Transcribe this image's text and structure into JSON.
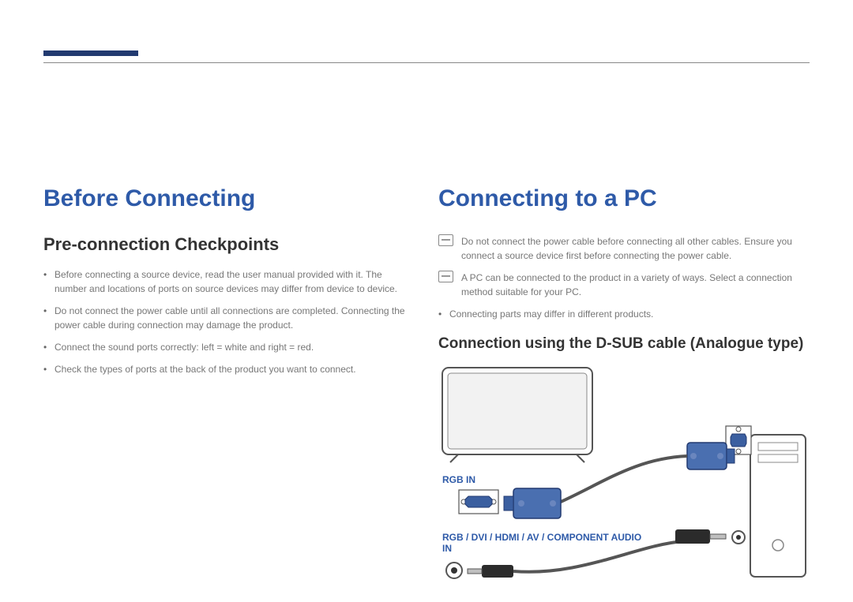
{
  "left": {
    "heading": "Before Connecting",
    "subheading": "Pre-connection Checkpoints",
    "bullets": [
      "Before connecting a source device, read the user manual provided with it.\nThe number and locations of ports on source devices may differ from device to device.",
      "Do not connect the power cable until all connections are completed.\nConnecting the power cable during connection may damage the product.",
      "Connect the sound ports correctly: left = white and right = red.",
      "Check the types of ports at the back of the product you want to connect."
    ]
  },
  "right": {
    "heading": "Connecting to a PC",
    "notes": [
      "Do not connect the power cable before connecting all other cables.\nEnsure you connect a source device first before connecting the power cable.",
      "A PC can be connected to the product in a variety of ways.\nSelect a connection method suitable for your PC."
    ],
    "bullets": [
      "Connecting parts may differ in different products."
    ],
    "subheading": "Connection using the D-SUB cable (Analogue type)",
    "port_rgb_in": "RGB IN",
    "port_audio_in": "RGB / DVI / HDMI / AV / COMPONENT AUDIO IN"
  },
  "hint_label": "―"
}
